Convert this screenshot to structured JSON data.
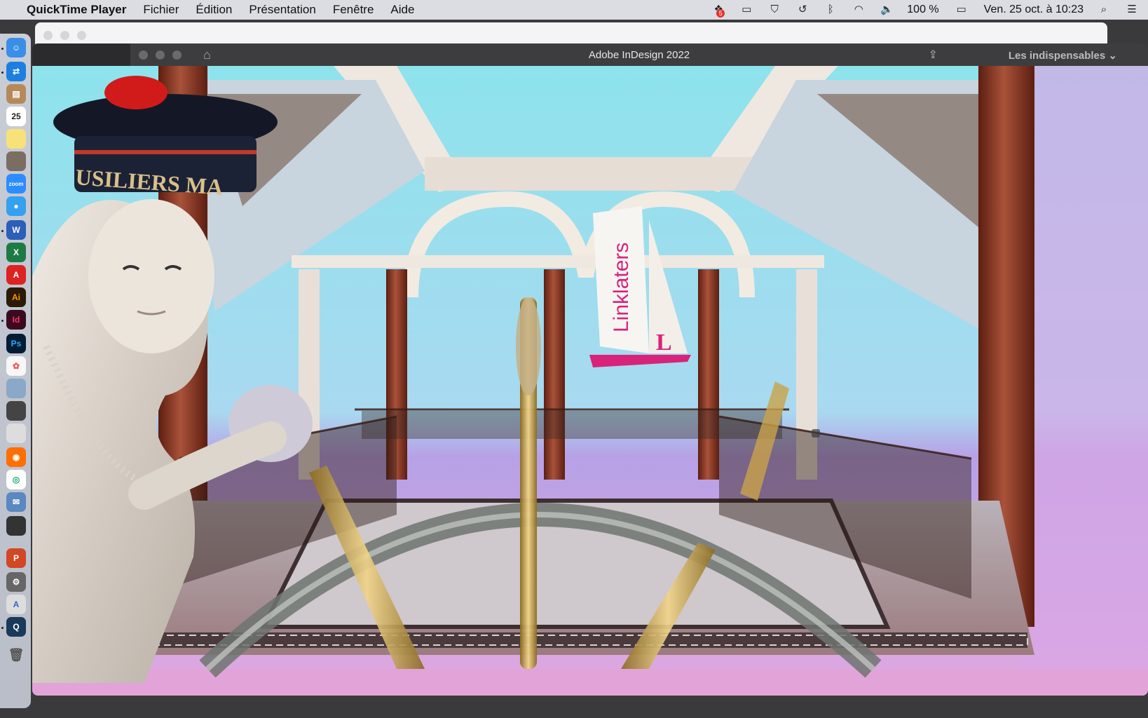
{
  "menubar": {
    "app_name": "QuickTime Player",
    "items": [
      "Fichier",
      "Édition",
      "Présentation",
      "Fenêtre",
      "Aide"
    ],
    "battery_text": "100 %",
    "clock": "Ven. 25 oct. à 10:23",
    "status_icons": [
      "dropbox-icon",
      "display-icon",
      "shield-icon",
      "time-machine-icon",
      "bluetooth-icon",
      "wifi-icon",
      "volume-icon",
      "battery-icon",
      "search-icon",
      "control-center-icon"
    ]
  },
  "dock": {
    "apps": [
      "finder",
      "teamviewer",
      "contacts",
      "calendar",
      "notes",
      "calculator",
      "zoom",
      "messages",
      "word",
      "excel",
      "acrobat",
      "illustrator",
      "indesign",
      "photoshop",
      "photos",
      "preview",
      "scanner",
      "drive",
      "firefox",
      "chrome",
      "mail",
      "keyboard",
      "powerpoint",
      "system-preferences",
      "app-store",
      "quicktime",
      "trash"
    ],
    "calendar_day": "25"
  },
  "window": {
    "title": "Adobe InDesign 2022",
    "workspace_label": "Les indispensables",
    "workspace_chevron": "⌄"
  },
  "scene": {
    "sail_text": "Linklaters",
    "sail_logo": "L",
    "cap_text": "USILIERS MA",
    "colors": {
      "sky": "#8de3ec",
      "pink": "#e89ad8",
      "column": "#8a3a24",
      "brass": "#c9a24a",
      "sail_text": "#d8237a"
    }
  }
}
